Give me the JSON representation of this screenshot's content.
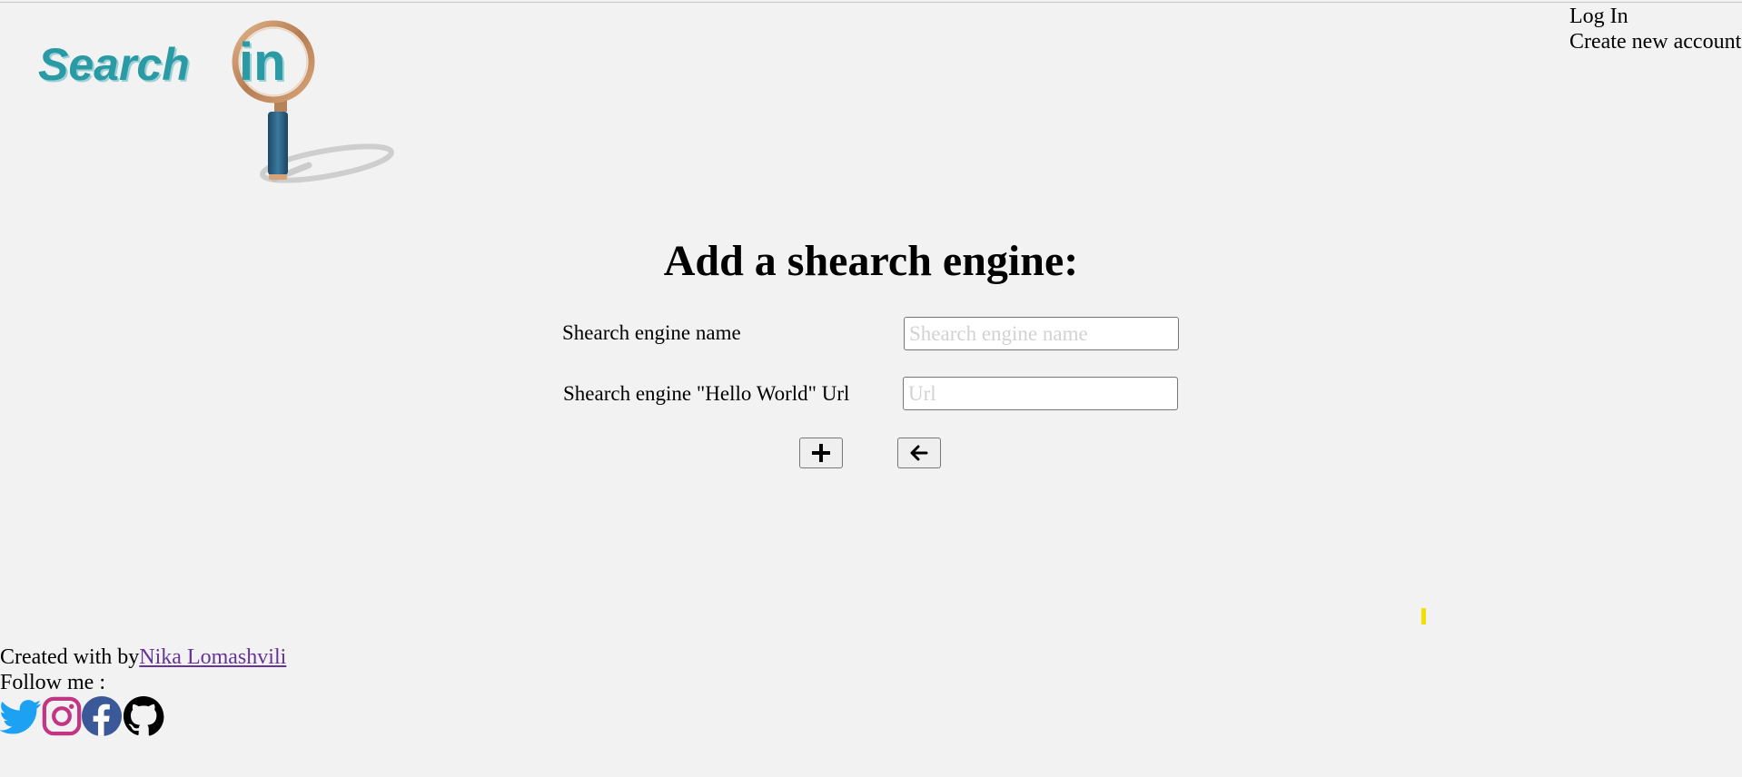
{
  "logo": {
    "word_search": "Search",
    "word_in": "in"
  },
  "auth": {
    "login": "Log In",
    "create": "Create new account"
  },
  "form": {
    "title": "Add a shearch engine:",
    "name_label": "Shearch engine name",
    "name_placeholder": "Shearch engine name",
    "url_label": "Shearch engine \"Hello World\" Url",
    "url_placeholder": "Url",
    "add_icon": "plus-icon",
    "back_icon": "arrow-left-icon"
  },
  "footer": {
    "created_prefix": "Created with by",
    "author": "Nika Lomashvili",
    "follow": "Follow me :",
    "socials": [
      {
        "icon": "twitter-icon",
        "color": "#1da1f2"
      },
      {
        "icon": "instagram-icon",
        "color": "#c13584"
      },
      {
        "icon": "facebook-icon",
        "color": "#3b5998"
      },
      {
        "icon": "github-icon",
        "color": "#000000"
      }
    ]
  },
  "colors": {
    "background": "#f2f2f2",
    "logo_teal": "#2a9aa5",
    "logo_ring": "#c8936a",
    "handle_blue": "#2b5f7f",
    "author_link": "#663399",
    "marker_yellow": "#f2e000"
  }
}
